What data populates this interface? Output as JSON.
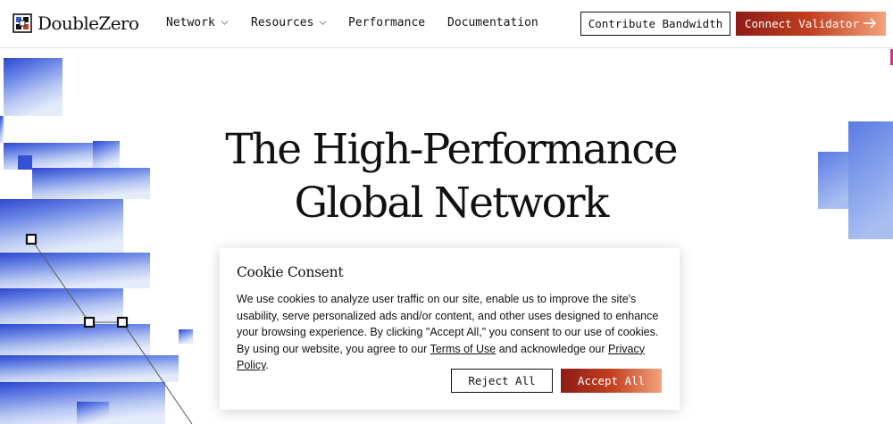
{
  "brand": {
    "name": "DoubleZero",
    "logo_icon": "doublezero-logo-icon"
  },
  "nav": {
    "items": [
      {
        "label": "Network",
        "has_dropdown": true
      },
      {
        "label": "Resources",
        "has_dropdown": true
      },
      {
        "label": "Performance",
        "has_dropdown": false
      },
      {
        "label": "Documentation",
        "has_dropdown": false
      }
    ],
    "contribute_label": "Contribute Bandwidth",
    "connect_label": "Connect Validator",
    "connect_icon": "arrow-right-icon"
  },
  "hero": {
    "title_line1": "The High-Performance",
    "title_line2": "Global Network"
  },
  "cookie": {
    "title": "Cookie Consent",
    "text_part1": "We use cookies to analyze user traffic on our site, enable us to improve the site's usability, serve personalized ads and/or content, and other uses designed to enhance your browsing experience. By clicking \"Accept All,\" you consent to our use of cookies. By using our website, you agree to our ",
    "terms_link": "Terms of Use",
    "text_part2": " and acknowledge our ",
    "privacy_link": "Privacy Policy",
    "text_end": ".",
    "reject_label": "Reject All",
    "accept_label": "Accept All"
  },
  "colors": {
    "accent_dark_red": "#8e1b16",
    "accent_orange": "#c2401f",
    "accent_peach": "#f3a27e",
    "art_blue": "#3d5bd6",
    "art_light_blue": "#a8bdf0"
  }
}
